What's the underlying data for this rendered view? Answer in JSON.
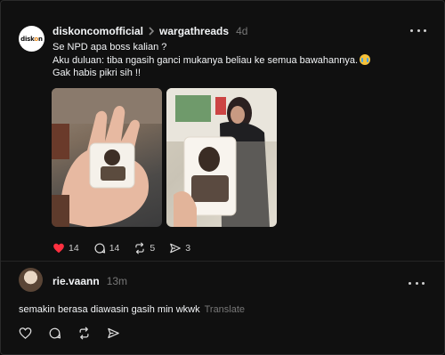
{
  "post": {
    "avatar_logo": {
      "prefix": "disk",
      "accent": "o",
      "suffix": "n"
    },
    "username": "diskoncomofficial",
    "community": "wargathreads",
    "time": "4d",
    "text_lines": [
      "Se NPD apa boss kalian ?",
      "Aku duluan: tiba ngasih ganci mukanya beliau ke semua bawahannya.",
      "Gak habis pikri sih !!"
    ],
    "emoji_icon": "loudly-crying-face-emoji",
    "likes": "14",
    "comments": "14",
    "reposts": "5",
    "shares": "3",
    "liked": true,
    "like_color": "#ff3040"
  },
  "reply": {
    "username": "rie.vaann",
    "time": "13m",
    "text": "semakin berasa diawasin gasih min wkwk",
    "translate_label": "Translate"
  },
  "colors": {
    "background": "#101010",
    "text": "#f3f5f7",
    "muted": "#777777"
  }
}
